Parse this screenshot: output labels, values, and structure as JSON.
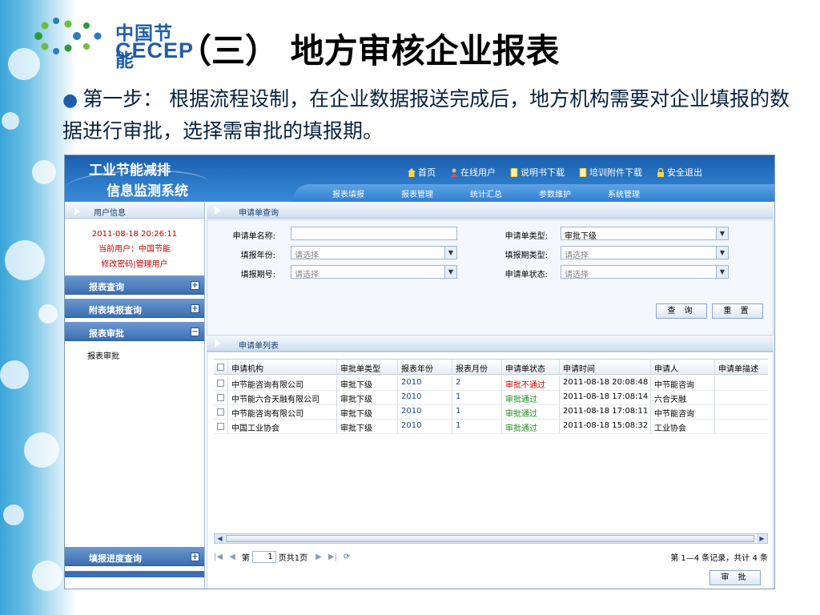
{
  "slide": {
    "logo_cn": "中国节能",
    "logo_en": "CECEP",
    "title": "（三） 地方审核企业报表",
    "body": "第一步： 根据流程设制，在企业数据报送完成后，地方机构需要对企业填报的数据进行审批，选择需审批的填报期。"
  },
  "app": {
    "logo_line1": "工业节能减排",
    "logo_line2": "信息监测系统",
    "top_links": [
      {
        "label": "首页",
        "icon": "home-icon"
      },
      {
        "label": "在线用户",
        "icon": "users-icon"
      },
      {
        "label": "说明书下载",
        "icon": "document-icon"
      },
      {
        "label": "培训附件下载",
        "icon": "document-icon"
      },
      {
        "label": "安全退出",
        "icon": "lock-icon"
      }
    ],
    "nav": [
      "报表填报",
      "报表管理",
      "统计汇总",
      "参数维护",
      "系统管理"
    ],
    "sidebar": {
      "user_info_title": "用户信息",
      "datetime": "2011-08-18 20:26:11",
      "current_user": "当前用户：中国节能",
      "links": "修改密码|管理用户",
      "sections": [
        "报表查询",
        "附表填报查询",
        "报表审批"
      ],
      "sub_item": "报表审批",
      "bottom_section": "填报进度查询"
    },
    "query": {
      "panel_title": "申请单查询",
      "name_label": "申请单名称:",
      "name_value": "",
      "year_label": "填报年份:",
      "year_placeholder": "请选择",
      "period_label": "填报期号:",
      "period_placeholder": "请选择",
      "type_label": "申请单类型:",
      "type_value": "审批下级",
      "period_type_label": "填报期类型:",
      "period_type_placeholder": "请选择",
      "status_label": "申请单状态:",
      "status_placeholder": "请选择",
      "search_button": "查 询",
      "reset_button": "重 置"
    },
    "list": {
      "panel_title": "申请单列表",
      "columns": [
        "申请机构",
        "审批单类型",
        "报表年份",
        "报表月份",
        "申请单状态",
        "申请时间",
        "申请人",
        "申请单描述"
      ],
      "rows": [
        {
          "org": "中节能咨询有限公司",
          "type": "审批下级",
          "year": "2010",
          "month": "2",
          "status": "审批不通过",
          "time": "2011-08-18 20:08:48",
          "applicant": "中节能咨询",
          "desc": ""
        },
        {
          "org": "中节能六合天融有限公司",
          "type": "审批下级",
          "year": "2010",
          "month": "1",
          "status": "审批通过",
          "time": "2011-08-18 17:08:14",
          "applicant": "六合天融",
          "desc": ""
        },
        {
          "org": "中节能咨询有限公司",
          "type": "审批下级",
          "year": "2010",
          "month": "1",
          "status": "审批通过",
          "time": "2011-08-18 17:08:11",
          "applicant": "中节能咨询",
          "desc": ""
        },
        {
          "org": "中国工业协会",
          "type": "审批下级",
          "year": "2010",
          "month": "1",
          "status": "审批通过",
          "time": "2011-08-18 15:08:32",
          "applicant": "工业协会",
          "desc": ""
        }
      ],
      "pager_prefix": "第",
      "pager_page": "1",
      "pager_suffix": "页共1页",
      "pager_summary": "第 1—4 条记录，共计 4 条",
      "approve_button": "审 批"
    }
  },
  "colors": {
    "header_blue": "#1a5fae",
    "fail": "#d00000",
    "pass": "#1e8a1e",
    "date_red": "#c00000"
  }
}
